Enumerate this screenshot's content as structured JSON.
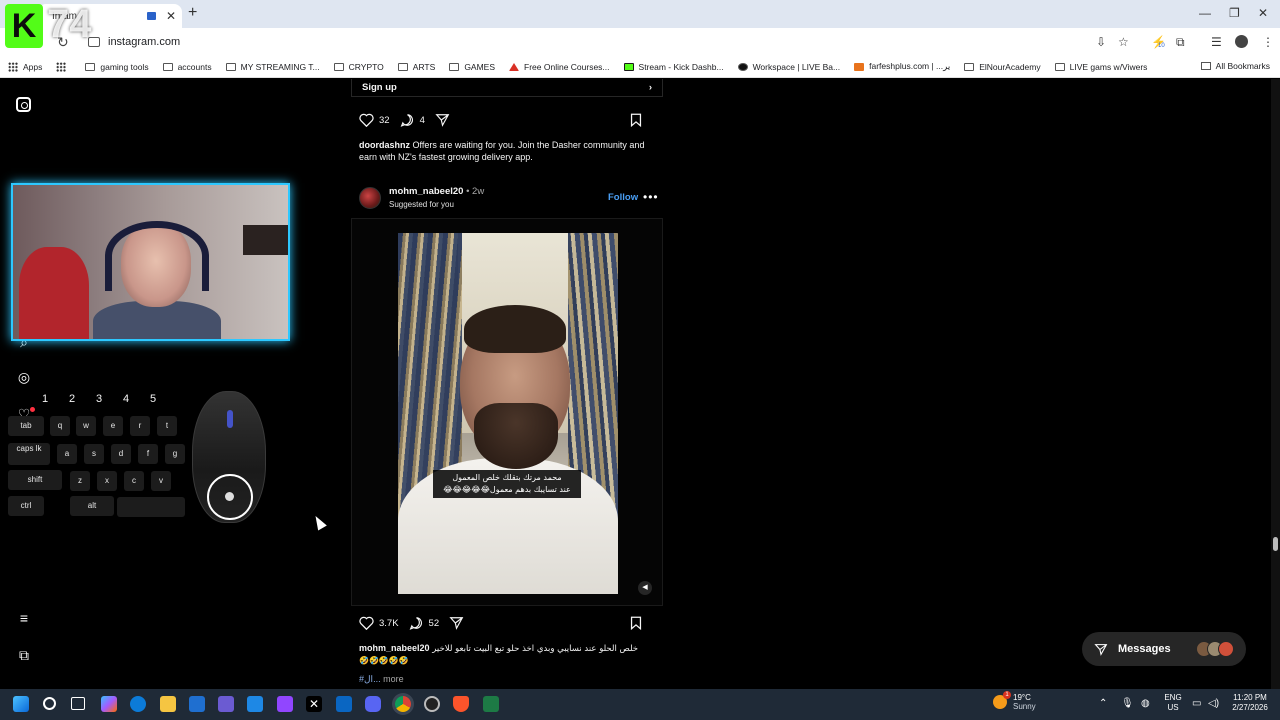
{
  "browser": {
    "tab_title": "In   am",
    "url": "instagram.com",
    "bookmarks": [
      {
        "label": "Apps",
        "icon": "grid"
      },
      {
        "label": "",
        "icon": "grid"
      },
      {
        "label": "gaming tools",
        "icon": "folder"
      },
      {
        "label": "accounts",
        "icon": "folder"
      },
      {
        "label": "MY STREAMING T...",
        "icon": "folder"
      },
      {
        "label": "CRYPTO",
        "icon": "folder"
      },
      {
        "label": "ARTS",
        "icon": "folder"
      },
      {
        "label": "GAMES",
        "icon": "folder"
      },
      {
        "label": "Free Online Courses...",
        "icon": "tri"
      },
      {
        "label": "Stream - Kick Dashb...",
        "icon": "kick"
      },
      {
        "label": "Workspace | LIVE Ba...",
        "icon": "black"
      },
      {
        "label": "farfeshplus.com | ...ير",
        "icon": "orange"
      },
      {
        "label": "ElNourAcademy",
        "icon": "folder"
      },
      {
        "label": "LIVE gams w/Viwers",
        "icon": "folder"
      }
    ],
    "all_bookmarks": "All Bookmarks",
    "extension_badge": "10"
  },
  "instagram": {
    "signup_label": "Sign up",
    "prev_post": {
      "likes": "32",
      "comments": "4",
      "caption_user": "doordashnz",
      "caption_text": " Offers are waiting for you. Join the Dasher community and earn with NZ's fastest growing delivery app."
    },
    "post": {
      "username": "mohm_nabeel20",
      "time": " • 2w",
      "subtitle": "Suggested for you",
      "follow_label": "Follow",
      "video_caption_line1": "محمد مرتك بتقلك خلص المعمول",
      "video_caption_line2": "عند تسايبك بدهم معمول😂😂😂😂😂",
      "likes": "3.7K",
      "comments": "52",
      "caption_user": "mohm_nabeel20",
      "caption_text": " خلص الحلو عند نسايبي وبدي اخذ حلو تبع البيت تابعو للاخير",
      "caption_emojis": "🤣🤣🤣🤣🤣",
      "hashtag": "#ال...",
      "more_label": "more"
    },
    "messages_label": "Messages"
  },
  "overlay": {
    "logo_letter": "K",
    "logo_number": "74",
    "number_keys": [
      "1",
      "2",
      "3",
      "4",
      "5"
    ],
    "letter_keys": {
      "row1": [
        "tab",
        "q",
        "w",
        "e",
        "r",
        "t"
      ],
      "row2": [
        "caps lk",
        "a",
        "s",
        "d",
        "f",
        "g"
      ],
      "row3": [
        "shift",
        "z",
        "x",
        "c",
        "v"
      ],
      "row4": [
        "ctrl",
        "alt"
      ]
    }
  },
  "taskbar": {
    "temperature": "19°C",
    "condition": "Sunny",
    "weather_badge": "1",
    "lang_line1": "ENG",
    "lang_line2": "US",
    "time": "11:20 PM",
    "date": "2/27/2026"
  },
  "colors": {
    "ig_blue": "#4a9ff5",
    "kick_green": "#53fc18",
    "webcam_glow": "#2dc8ff",
    "chrome_tabbar": "#dfe6f1",
    "taskbar": "#1f2a37"
  }
}
